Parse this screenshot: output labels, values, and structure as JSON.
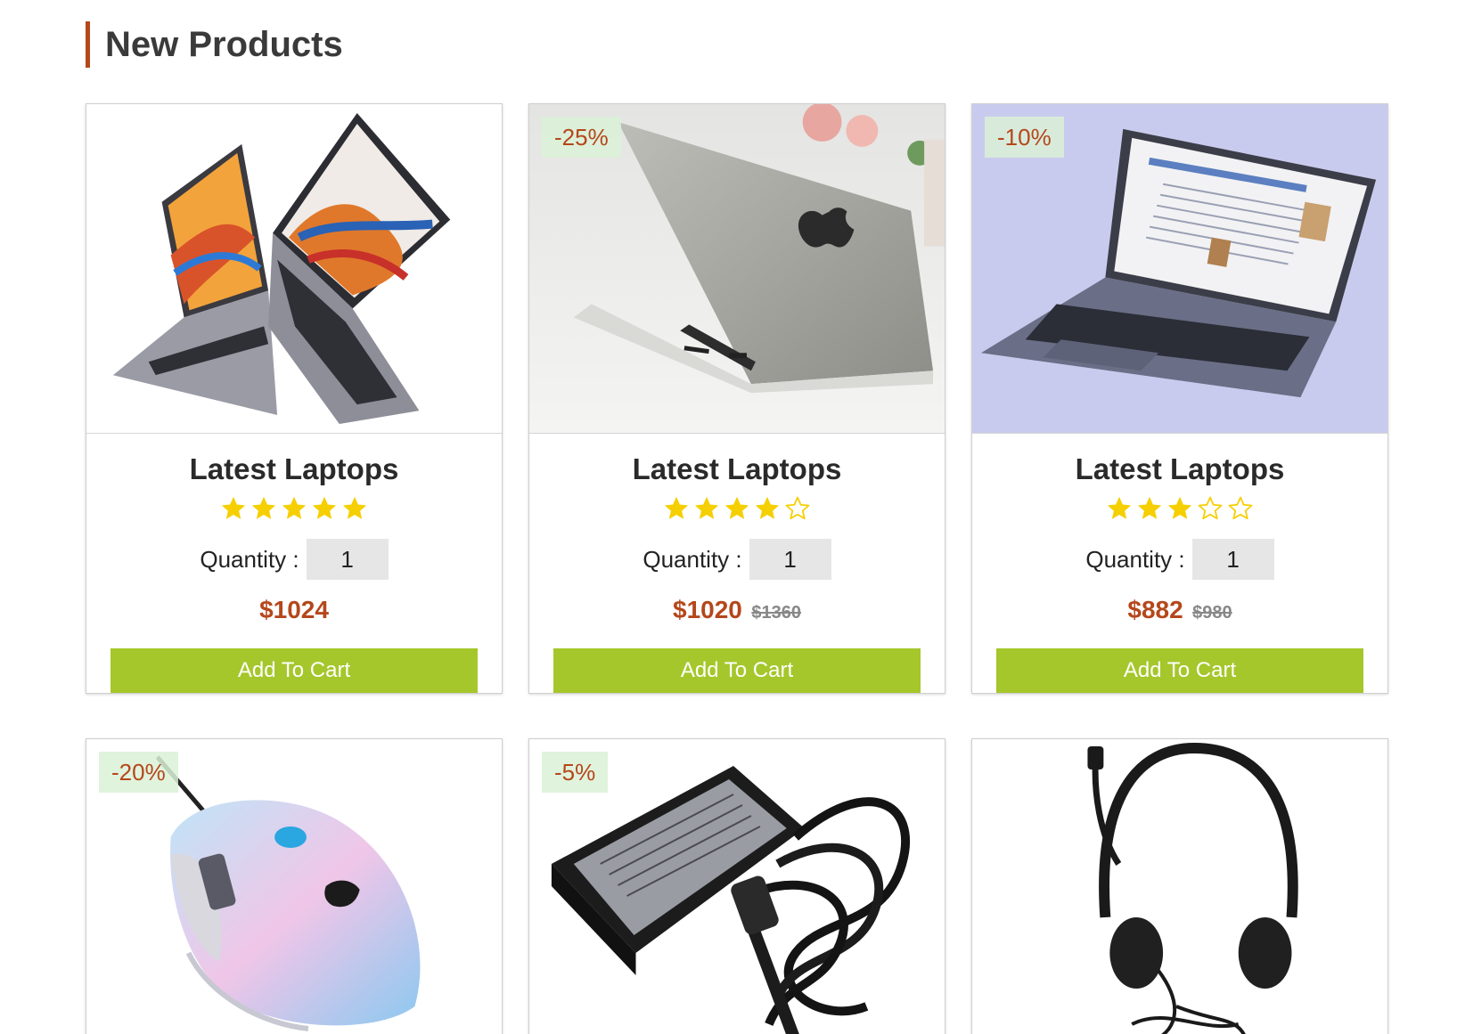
{
  "section": {
    "title": "New Products"
  },
  "colors": {
    "accent": "#b5471b",
    "button": "#a5c72b",
    "star": "#f6cf00"
  },
  "products": [
    {
      "badge": "",
      "title": "Latest Laptops",
      "rating": 5,
      "max_rating": 5,
      "quantity_label": "Quantity :",
      "quantity": "1",
      "price": "$1024",
      "old_price": "",
      "button": "Add To Cart",
      "image": "laptop-pair-image"
    },
    {
      "badge": "-25%",
      "title": "Latest Laptops",
      "rating": 4,
      "max_rating": 5,
      "quantity_label": "Quantity :",
      "quantity": "1",
      "price": "$1020",
      "old_price": "$1360",
      "button": "Add To Cart",
      "image": "silver-laptop-image"
    },
    {
      "badge": "-10%",
      "title": "Latest Laptops",
      "rating": 3,
      "max_rating": 5,
      "quantity_label": "Quantity :",
      "quantity": "1",
      "price": "$882",
      "old_price": "$980",
      "button": "Add To Cart",
      "image": "open-laptop-image"
    },
    {
      "badge": "-20%",
      "image": "gaming-mouse-image"
    },
    {
      "badge": "-5%",
      "image": "ac-adapter-image"
    },
    {
      "badge": "",
      "image": "headset-image"
    }
  ]
}
